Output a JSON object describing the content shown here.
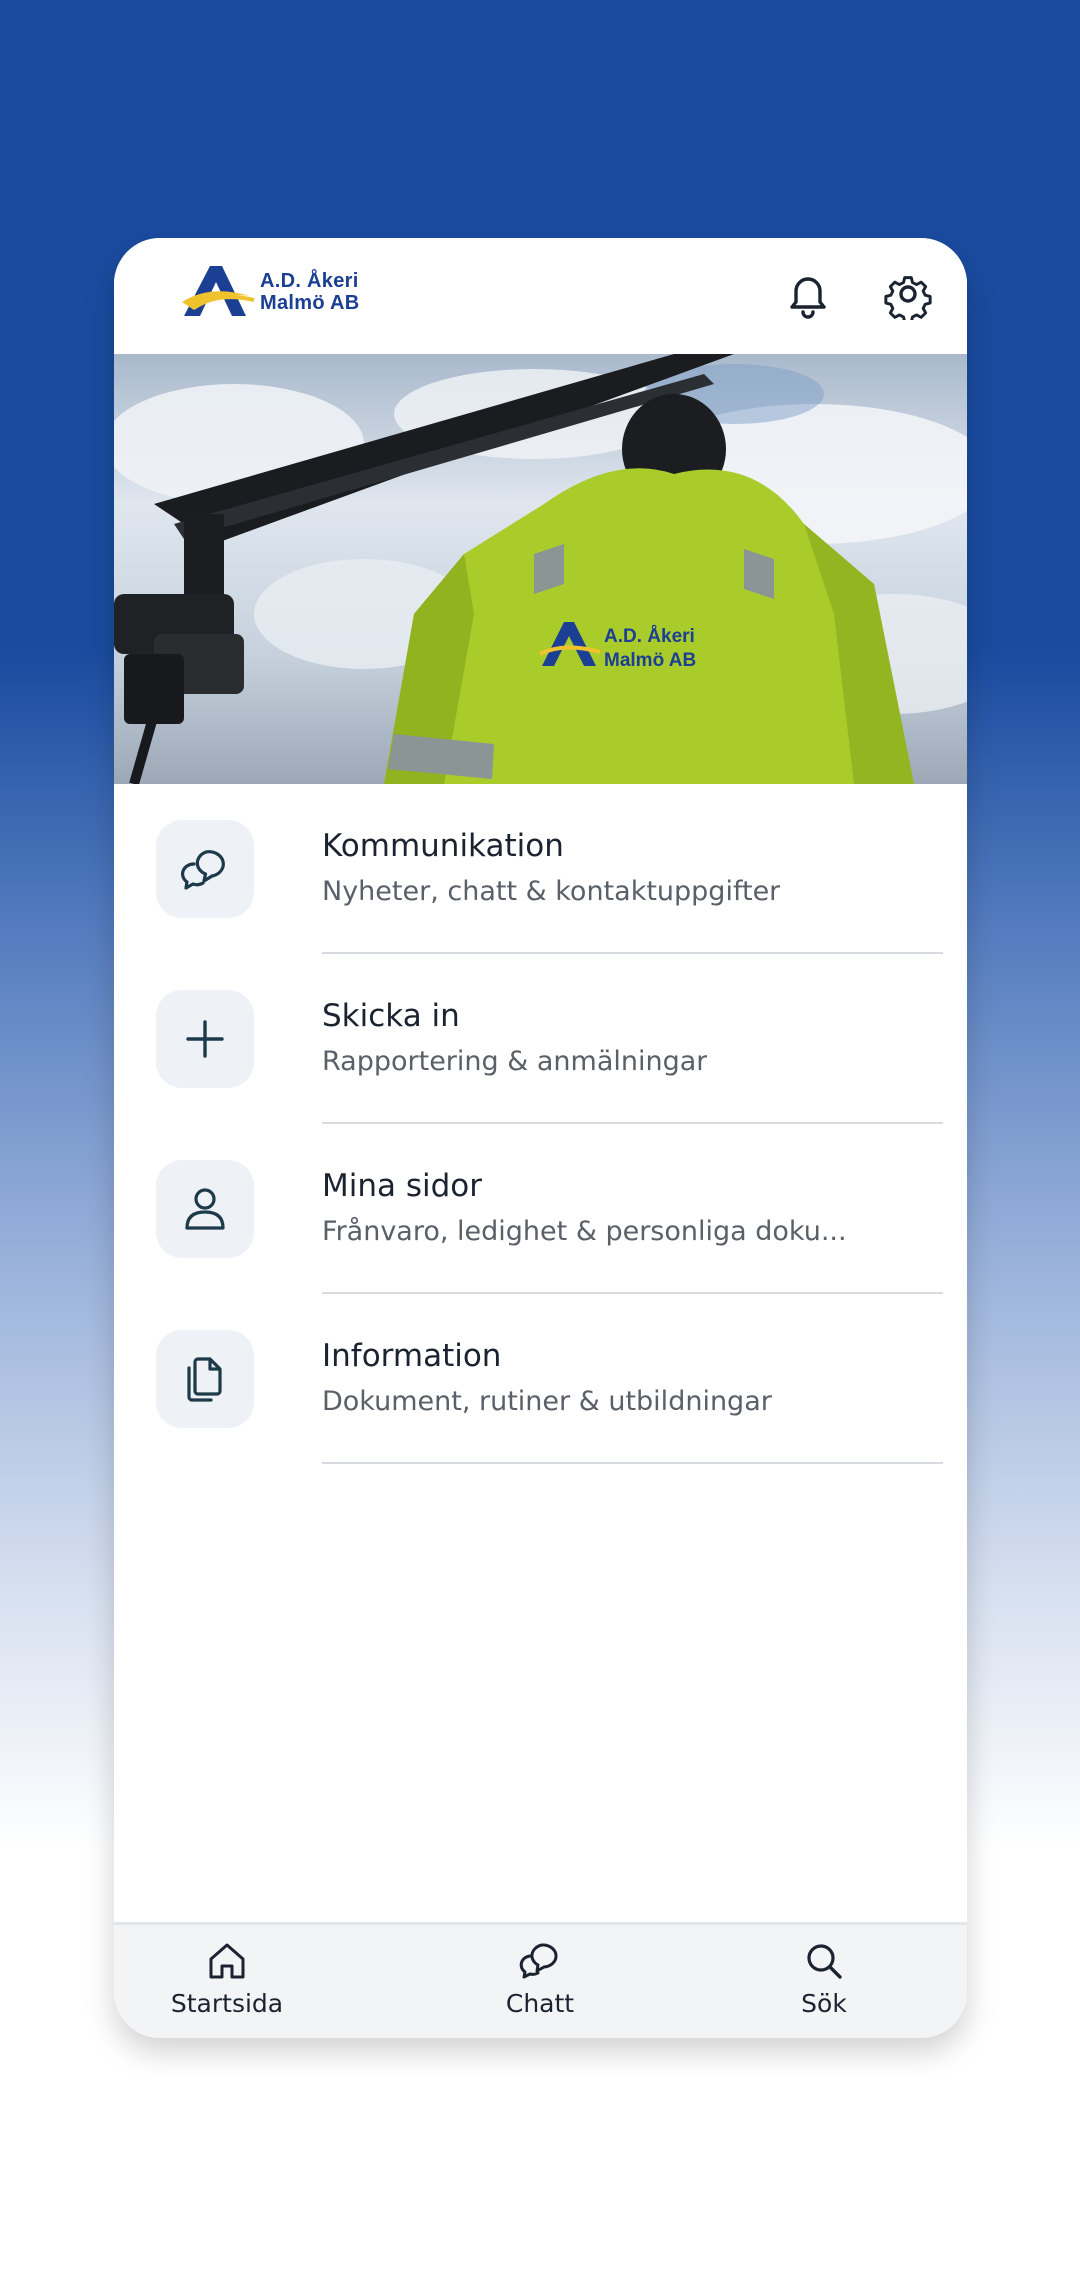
{
  "header": {
    "logo_line1": "A.D. Åkeri",
    "logo_line2": "Malmö AB",
    "icons": [
      "bell-icon",
      "gear-icon"
    ]
  },
  "hero": {
    "jacket_line1": "A.D. Åkeri",
    "jacket_line2": "Malmö AB"
  },
  "menu": {
    "items": [
      {
        "title": "Kommunikation",
        "subtitle": "Nyheter, chatt & kontaktuppgifter",
        "icon": "chat-bubbles-icon"
      },
      {
        "title": "Skicka in",
        "subtitle": "Rapportering & anmälningar",
        "icon": "plus-icon"
      },
      {
        "title": "Mina sidor",
        "subtitle": "Frånvaro, ledighet & personliga doku...",
        "icon": "person-icon"
      },
      {
        "title": "Information",
        "subtitle": "Dokument, rutiner & utbildningar",
        "icon": "documents-icon"
      }
    ]
  },
  "bottom_nav": {
    "items": [
      {
        "label": "Startsida",
        "icon": "home-icon"
      },
      {
        "label": "Chatt",
        "icon": "chat-icon"
      },
      {
        "label": "Sök",
        "icon": "search-icon"
      }
    ]
  },
  "colors": {
    "background_top": "#1a4b9f",
    "icon_stroke": "#1c3a4a",
    "text_primary": "#1c2330",
    "text_secondary": "#5a6068"
  }
}
